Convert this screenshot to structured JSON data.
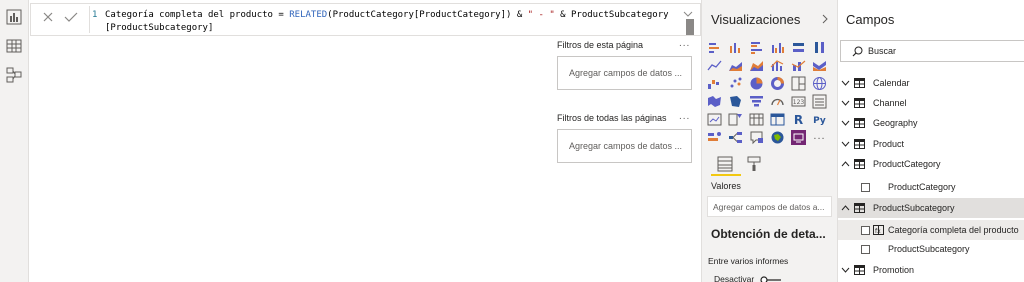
{
  "formula_bar": {
    "line_number": "1",
    "code_line1_a": "Categoría completa del producto = ",
    "code_line1_fn": "RELATED",
    "code_line1_b": "(ProductCategory[ProductCategory]) & ",
    "code_line1_str": "\" - \"",
    "code_line1_c": " & ProductSubcategory",
    "code_line2": "[ProductSubcategory]"
  },
  "filters": {
    "page_section": "Filtros de esta página",
    "page_well": "Agregar campos de datos ...",
    "all_section": "Filtros de todas las páginas",
    "all_well": "Agregar campos de datos ...",
    "more": "..."
  },
  "visualizations": {
    "title": "Visualizaciones",
    "values_label": "Valores",
    "values_well": "Agregar campos de datos a...",
    "drillthrough_title": "Obtención de deta...",
    "cross_report": "Entre varios informes",
    "deactivate": "Desactivar",
    "r_letter": "R",
    "py_letters": "Py",
    "more": "...",
    "accent": "#f2c811"
  },
  "fields": {
    "title": "Campos",
    "search_placeholder": "Buscar",
    "tables": [
      {
        "label": "Calendar"
      },
      {
        "label": "Channel"
      },
      {
        "label": "Geography"
      },
      {
        "label": "Product"
      },
      {
        "label": "ProductCategory"
      },
      {
        "label": "ProductSubcategory"
      },
      {
        "label": "Promotion"
      }
    ],
    "productcategory_fields": [
      {
        "label": "ProductCategory"
      }
    ],
    "productsubcategory_fields": [
      {
        "label": "Categoría completa del producto"
      },
      {
        "label": "ProductSubcategory"
      }
    ]
  }
}
